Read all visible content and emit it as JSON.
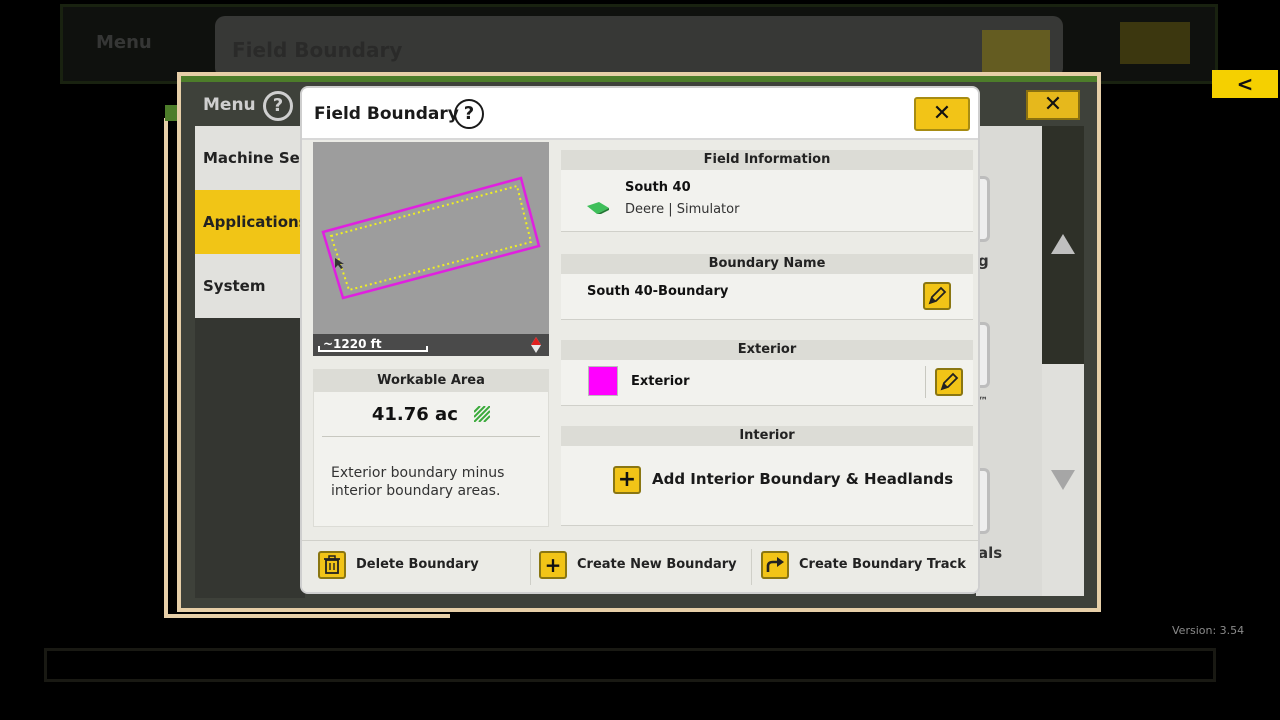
{
  "background": {
    "ghost_menu_label": "Menu",
    "ghost_title": "Field Boundary",
    "menu_label": "Menu",
    "sidebar": [
      {
        "label": "Machine Settings"
      },
      {
        "label": "Applications"
      },
      {
        "label": "System"
      }
    ],
    "tile_labels": [
      "g",
      "™",
      "als"
    ],
    "back_label": "<",
    "version": "Version:  3.54"
  },
  "dialog": {
    "title": "Field Boundary",
    "close_label": "✕",
    "map": {
      "scale_label": "~1220 ft",
      "boundary_color": "#e020e0",
      "headland_color": "#f0f020"
    },
    "workable_area": {
      "header": "Workable Area",
      "value": "41.76 ac",
      "description": "Exterior boundary minus interior boundary areas."
    },
    "field_information": {
      "header": "Field Information",
      "field_name": "South 40",
      "field_sub": "Deere | Simulator"
    },
    "boundary_name": {
      "header": "Boundary Name",
      "value": "South 40-Boundary"
    },
    "exterior": {
      "header": "Exterior",
      "label": "Exterior",
      "swatch_color": "#ff00ff"
    },
    "interior": {
      "header": "Interior",
      "add_label": "Add Interior Boundary & Headlands"
    },
    "footer": {
      "delete_label": "Delete Boundary",
      "create_label": "Create New Boundary",
      "track_label": "Create Boundary Track"
    }
  },
  "colors": {
    "accent_yellow": "#f2c417",
    "jd_green": "#4d7d2a"
  }
}
